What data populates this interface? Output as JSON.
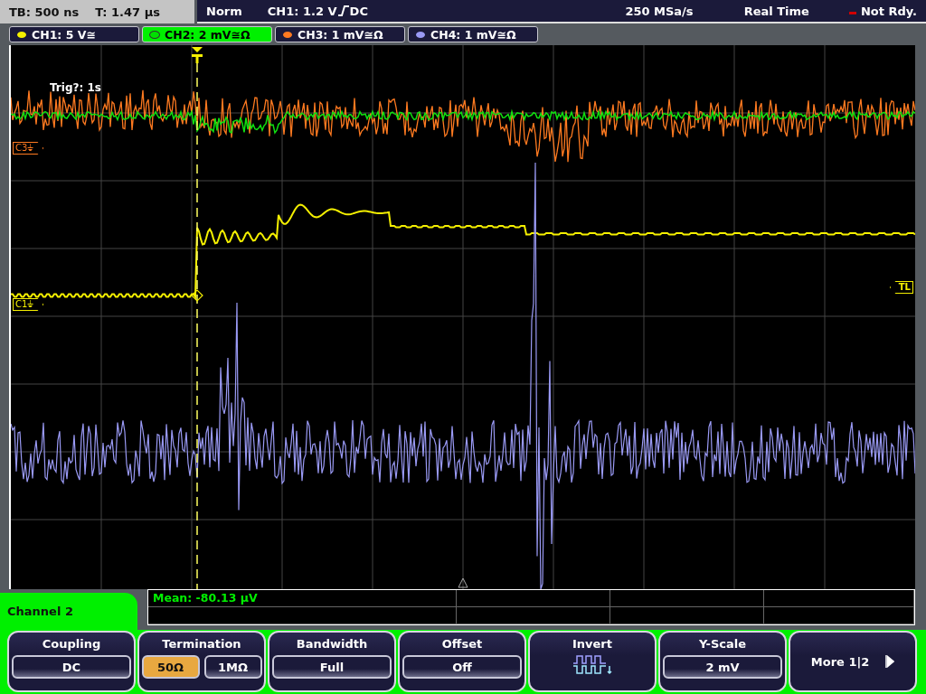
{
  "status_bar": {
    "timebase": "TB: 500 ns",
    "trigger_time": "T: 1.47 µs",
    "mode": "Norm",
    "trigger_source": "CH1: 1.2 V",
    "trigger_coupling": "DC",
    "sample_rate": "250 MSa/s",
    "acquisition": "Real Time",
    "state": "Not Rdy."
  },
  "channel_tabs": [
    {
      "label": "CH1: 5 V≅",
      "selected": false,
      "color": "#f5f000"
    },
    {
      "label": "CH2: 2 mV≅Ω",
      "selected": true,
      "color": "#00e000"
    },
    {
      "label": "CH3: 1 mV≅Ω",
      "selected": false,
      "color": "#ff7a20"
    },
    {
      "label": "CH4: 1 mV≅Ω",
      "selected": false,
      "color": "#9a9af5"
    }
  ],
  "scope": {
    "trigger_info": "Trig?: 1s",
    "markers": [
      {
        "label": "C3⏚",
        "color": "#ff7a20"
      },
      {
        "label": "C1⏚",
        "color": "#f5f000"
      }
    ],
    "trigger_level_label": "TL"
  },
  "measurement": {
    "text": "Mean: -80.13 µV"
  },
  "menu": {
    "title": "Channel 2"
  },
  "softkeys": [
    {
      "kind": "single",
      "title": "Coupling",
      "options": [
        {
          "label": "DC"
        }
      ]
    },
    {
      "kind": "toggle",
      "title": "Termination",
      "options": [
        {
          "label": "50Ω",
          "selected": true
        },
        {
          "label": "1MΩ",
          "selected": false
        }
      ]
    },
    {
      "kind": "single",
      "title": "Bandwidth",
      "options": [
        {
          "label": "Full"
        }
      ]
    },
    {
      "kind": "single",
      "title": "Offset",
      "options": [
        {
          "label": "Off"
        }
      ]
    },
    {
      "kind": "icon",
      "title": "Invert"
    },
    {
      "kind": "single",
      "title": "Y-Scale",
      "options": [
        {
          "label": "2 mV"
        }
      ]
    },
    {
      "kind": "more",
      "title": "More 1|2"
    }
  ]
}
